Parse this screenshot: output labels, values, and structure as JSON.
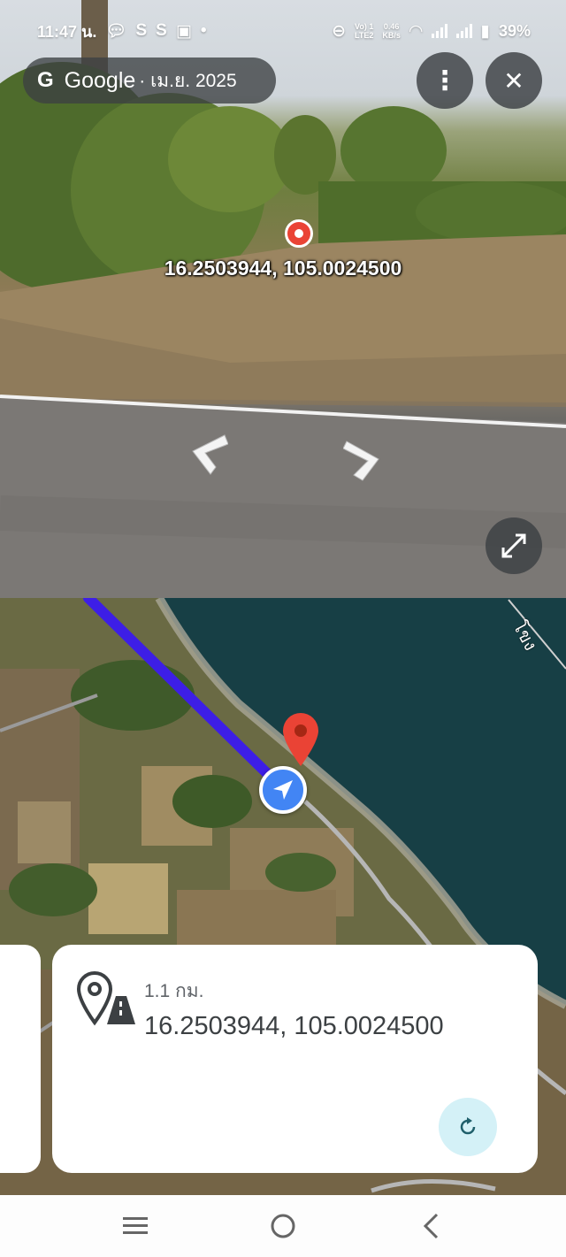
{
  "status_bar": {
    "time": "11:47 น.",
    "left_icons": [
      "chat-bubble-icon",
      "s-app-icon",
      "s-app-icon",
      "sticker-app-icon",
      "dot-icon"
    ],
    "volte": "Vo) 1\nLTE2",
    "speed": "0.46\nKB/s",
    "battery": "39%"
  },
  "street_view": {
    "chip_brand": "Google",
    "chip_date": "· เม.ย. 2025",
    "coordinates": "16.2503944, 105.0024500"
  },
  "map": {
    "river_label": "โขง"
  },
  "info_card": {
    "distance": "1.1 กม.",
    "coordinates": "16.2503944, 105.0024500"
  },
  "colors": {
    "accent_blue": "#4285f4",
    "route_purple": "#3d1ee6",
    "pin_red": "#ea4335",
    "refresh_bg": "#d4f1f7"
  }
}
